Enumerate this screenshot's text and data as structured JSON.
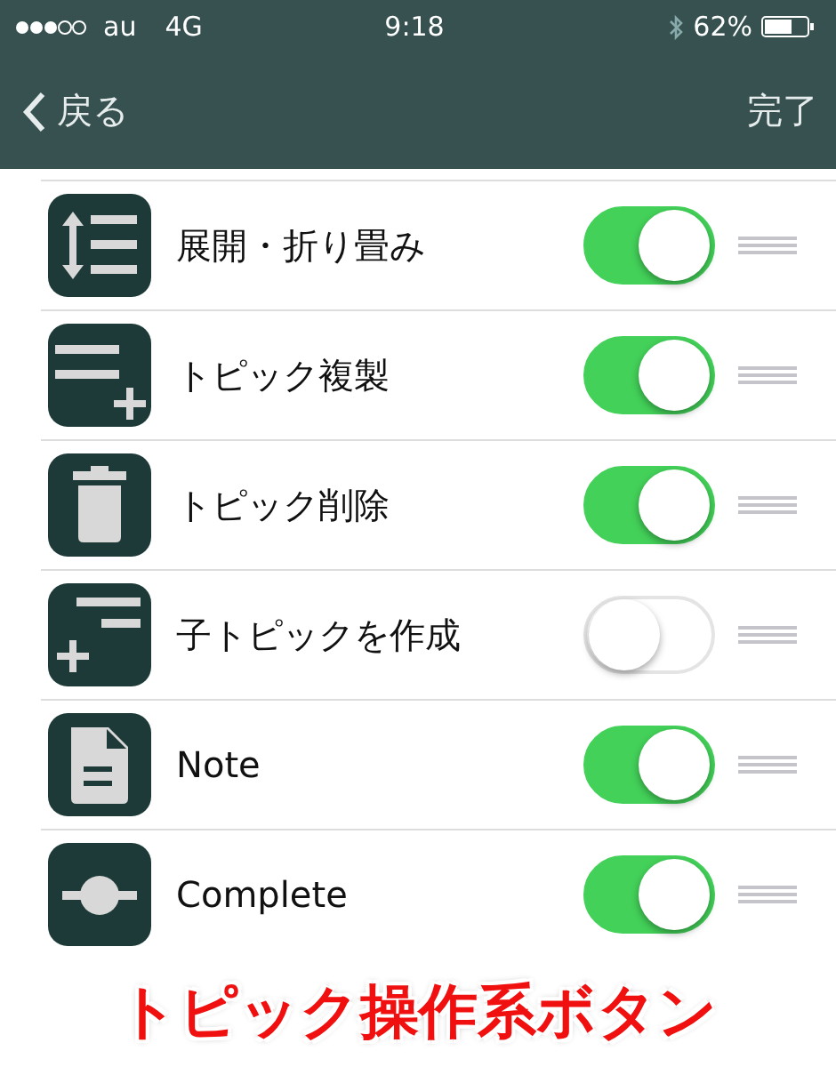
{
  "status_bar": {
    "carrier": "au",
    "network": "4G",
    "time": "9:18",
    "battery": "62%"
  },
  "nav": {
    "back": "戻る",
    "done": "完了"
  },
  "items": [
    {
      "kind": "expand",
      "label": "展開・折り畳み",
      "on": true
    },
    {
      "kind": "duplicate",
      "label": "トピック複製",
      "on": true
    },
    {
      "kind": "delete",
      "label": "トピック削除",
      "on": true
    },
    {
      "kind": "child",
      "label": "子トピックを作成",
      "on": false
    },
    {
      "kind": "note",
      "label": "Note",
      "on": true
    },
    {
      "kind": "complete",
      "label": "Complete",
      "on": true
    }
  ],
  "caption": "トピック操作系ボタン"
}
